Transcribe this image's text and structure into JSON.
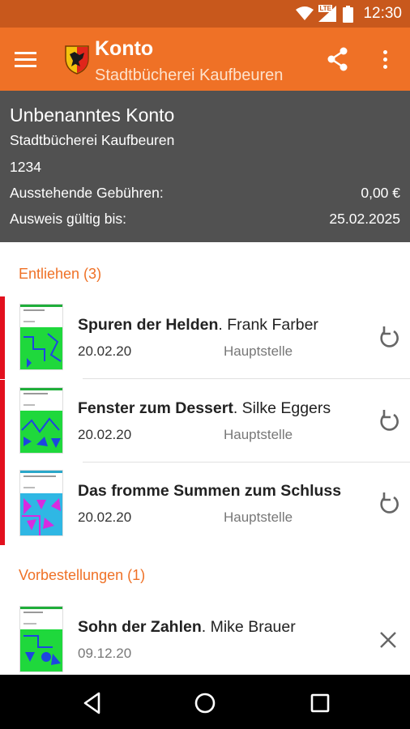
{
  "status_bar": {
    "time": "12:30",
    "network": "LTE",
    "icons": [
      "wifi-icon",
      "signal-icon",
      "battery-icon"
    ]
  },
  "toolbar": {
    "title": "Konto",
    "subtitle": "Stadtbücherei Kaufbeuren",
    "icons": [
      "menu-icon",
      "city-crest-icon",
      "share-icon",
      "overflow-menu-icon"
    ]
  },
  "account": {
    "name": "Unbenanntes Konto",
    "library": "Stadtbücherei Kaufbeuren",
    "number": "1234",
    "fees_label": "Ausstehende Gebühren:",
    "fees_value": "0,00 €",
    "valid_label": "Ausweis gültig bis:",
    "valid_value": "25.02.2025"
  },
  "lent": {
    "header": "Entliehen (3)",
    "items": [
      {
        "title": "Spuren der Helden",
        "author": ". Frank Farber",
        "date": "20.02.20",
        "branch": "Hauptstelle",
        "action_icon": "renew-icon"
      },
      {
        "title": "Fenster zum Dessert",
        "author": ". Silke Eggers",
        "date": "20.02.20",
        "branch": "Hauptstelle",
        "action_icon": "renew-icon"
      },
      {
        "title": "Das fromme Summen zum Schluss",
        "author": "",
        "date": "20.02.20",
        "branch": "Hauptstelle",
        "action_icon": "renew-icon"
      }
    ]
  },
  "reservations": {
    "header": "Vorbestellungen (1)",
    "items": [
      {
        "title": "Sohn der Zahlen",
        "author": ". Mike Brauer",
        "date": "09.12.20",
        "action_icon": "close-icon"
      }
    ]
  },
  "nav_bar": {
    "icons": [
      "back-icon",
      "home-icon",
      "recents-icon"
    ]
  },
  "colors": {
    "status_bar": "#c8581c",
    "toolbar": "#ef7126",
    "account_header": "#515151",
    "accent": "#ef7126",
    "overdue_marker": "#e2101e"
  }
}
